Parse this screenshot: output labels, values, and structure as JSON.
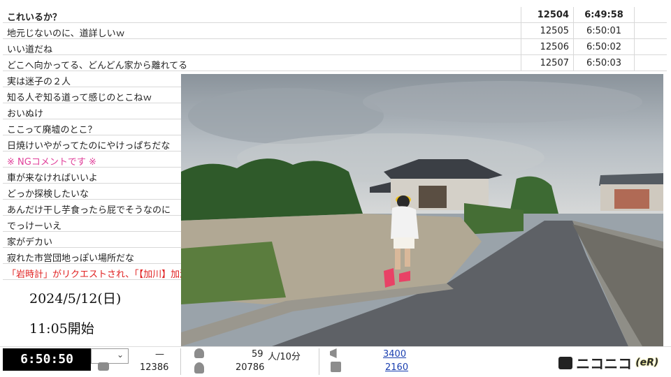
{
  "comments": [
    {
      "text": "これいるか？",
      "no": "12504",
      "time": "6:49:58"
    },
    {
      "text": "地元じないのに、道詳しいｗ",
      "no": "12505",
      "time": "6:50:01"
    },
    {
      "text": "いい道だね",
      "no": "12506",
      "time": "6:50:02"
    },
    {
      "text": "どこへ向かってる、どんどん家から離れてる",
      "no": "12507",
      "time": "6:50:03"
    },
    {
      "text": "実は迷子の２人"
    },
    {
      "text": "知る人ぞ知る道って感じのとこねｗ"
    },
    {
      "text": "おいぬけ"
    },
    {
      "text": "ここって廃墟のとこ？"
    },
    {
      "text": "日焼けいやがってたのにやけっぱちだな"
    },
    {
      "text": "※ NGコメントです ※"
    },
    {
      "text": "車が来なければいいよ"
    },
    {
      "text": "どっか探検したいな"
    },
    {
      "text": "あんだけ干し芋食ったら屁でそうなのに"
    },
    {
      "text": "でっけーいえ"
    },
    {
      "text": "家がデカい"
    },
    {
      "text": "寂れた市営団地っぽい場所だな"
    },
    {
      "text": "「岩時計」がリクエストされ、「【加川】加瀬の"
    }
  ],
  "overlay": {
    "date": "2024/5/12(日)",
    "start": "11:05開始"
  },
  "bar": {
    "current_time": "6:50:50",
    "dash": "—",
    "count1": "12386",
    "viewers": "59",
    "viewers_unit": "人/10分",
    "total": "20786",
    "ad_points": "3400",
    "gift_points": "2160",
    "logo_text": "ニコニコ",
    "logo_suffix": "(eR)"
  },
  "colors": {
    "ng": "#e0409a",
    "request": "#e02020",
    "link": "#1a3fb0"
  }
}
